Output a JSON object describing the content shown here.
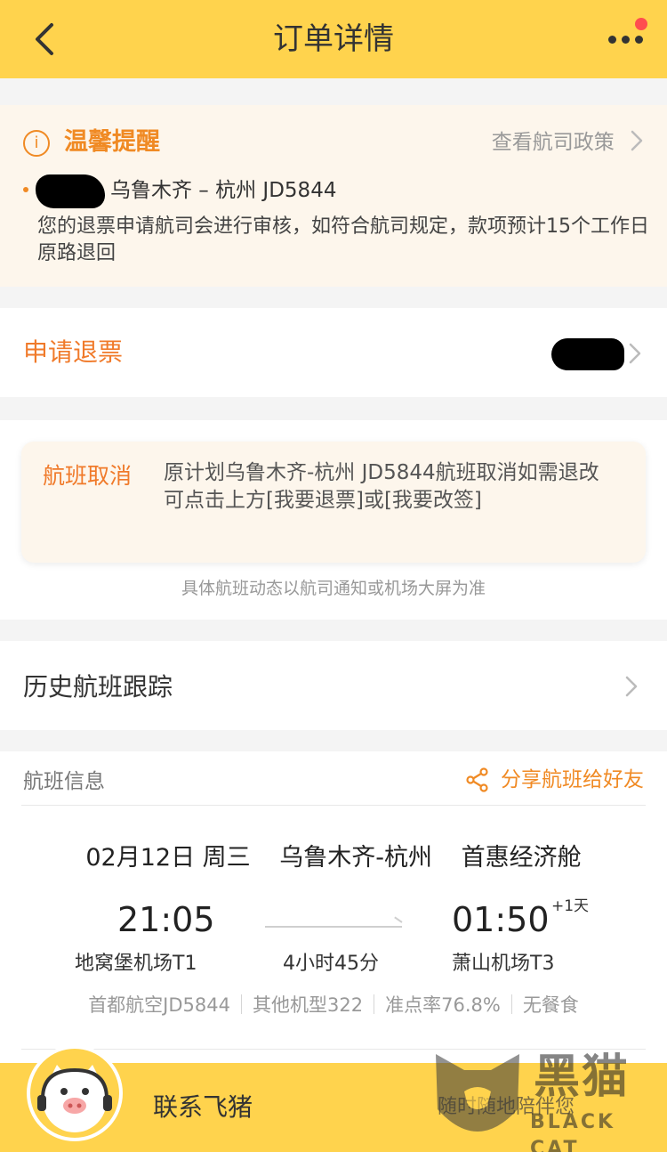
{
  "nav": {
    "back_icon": "chevron-left-icon",
    "title": "订单详情",
    "more_icon": "more-dots-icon"
  },
  "tip": {
    "icon": "info-icon",
    "title": "温馨提醒",
    "link": "查看航司政策",
    "route": "乌鲁木齐 – 杭州 JD5844",
    "body": "您的退票申请航司会进行审核，如符合航司规定，款项预计15个工作日原路退回"
  },
  "refund": {
    "label": "申请退票"
  },
  "cancel": {
    "tag": "航班取消",
    "text": "原计划乌鲁木齐-杭州 JD5844航班取消如需退改可点击上方[我要退票]或[我要改签]",
    "note": "具体航班动态以航司通知或机场大屏为准"
  },
  "history": {
    "label": "历史航班跟踪"
  },
  "flight": {
    "section_title": "航班信息",
    "share_label": "分享航班给好友",
    "date": "02月12日 周三",
    "route": "乌鲁木齐-杭州",
    "cabin": "首惠经济舱",
    "depart_time": "21:05",
    "arrive_time": "01:50",
    "plus_day": "+1天",
    "depart_airport": "地窝堡机场T1",
    "arrive_airport": "萧山机场T3",
    "duration": "4小时45分",
    "airline": "首都航空JD5844",
    "aircraft": "其他机型322",
    "punctuality": "准点率76.8%",
    "meal": "无餐食"
  },
  "bottom": {
    "contact_label": "联系飞猪",
    "accompany_label": "随时随地陪伴您",
    "avatar_icon": "pig-mascot-icon"
  },
  "watermark": {
    "brand_cn": "黑猫",
    "brand_en": "BLACK CAT"
  },
  "colors": {
    "accent_yellow": "#ffd34d",
    "accent_orange": "#f07a2a",
    "tip_bg": "#fdf6ec"
  }
}
